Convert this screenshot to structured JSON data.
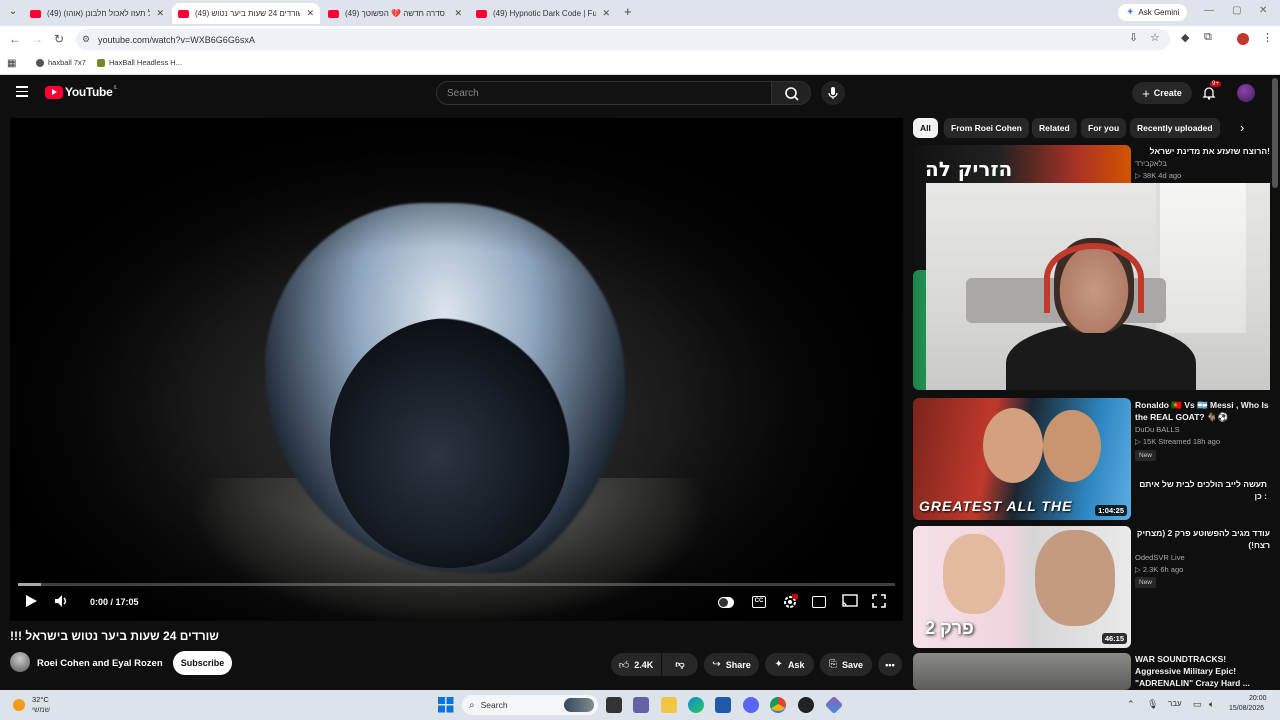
{
  "browser": {
    "tabs": [
      {
        "title": "אל תעזו לאכול חלבונן (אוהו) (49)",
        "active": false
      },
      {
        "title": "שורדים 24 שעות ביער נטוש (49)",
        "active": true
      },
      {
        "title": "סדרה חדשה 💔 הפשוטך (49)",
        "active": false
      },
      {
        "title": "(49) Hypnotic Dark Code | Futu",
        "active": false
      }
    ],
    "ask_gemini": "Ask Gemini",
    "url": "youtube.com/watch?v=WXB6G6G6sxA",
    "bookmarks": [
      "haxball 7x7",
      "HaxBall Headless H..."
    ]
  },
  "youtube": {
    "logo_text": "YouTube",
    "country_code": "IL",
    "search_placeholder": "Search",
    "create_label": "Create",
    "notifications_badge": "9+",
    "player": {
      "time": "0:00 / 17:05",
      "progress_fraction": 0.0
    },
    "video": {
      "title": "!!! שורדים 24 שעות ביער נטוש בישראל",
      "channel": "Roei Cohen and Eyal Rozen",
      "subscribe_label": "Subscribe",
      "likes": "2.4K",
      "share_label": "Share",
      "ask_label": "Ask",
      "save_label": "Save"
    },
    "chips": [
      "All",
      "From Roei Cohen",
      "Related",
      "For you",
      "Recently uploaded"
    ],
    "recommendations": [
      {
        "title": "הרוצח שזעזע את מדינת ישראל!",
        "channel": "בלאקבירד",
        "meta": "▷ 38K  4d ago",
        "thumb_text": "הזריק לה"
      },
      {
        "title": "Ronaldo 🇵🇹 Vs 🇦🇷 Messi , Who Is the REAL GOAT? 🐐⚽",
        "channel": "DuDu BALLS",
        "meta": "▷ 15K  Streamed 18h ago",
        "badge": "New",
        "duration": "1:04:25",
        "thumb_text": "GREATEST ALL THE"
      },
      {
        "title": "תעשה לייב הולכים לבית של איתם כן :",
        "channel": "",
        "meta": "",
        "badge": "",
        "duration": "",
        "thumb_text": ""
      },
      {
        "title": "עודד מגיב להפשוטע פרק 2 (מצחיק רצח!)",
        "channel": "OdedSVR Live",
        "meta": "▷ 2.3K  6h ago",
        "badge": "New",
        "duration": "46:15",
        "thumb_text": "פרק 2"
      },
      {
        "title": "WAR SOUNDTRACKS! Aggressive Military Epic! \"ADRENALIN\" Crazy Hard ...",
        "channel": "",
        "meta": ""
      }
    ]
  },
  "taskbar": {
    "weather_temp": "32°C",
    "weather_desc": "שמשי",
    "search_label": "Search",
    "clock_time": "20:00",
    "clock_date": "15/08/2026",
    "lang": "עבר"
  }
}
